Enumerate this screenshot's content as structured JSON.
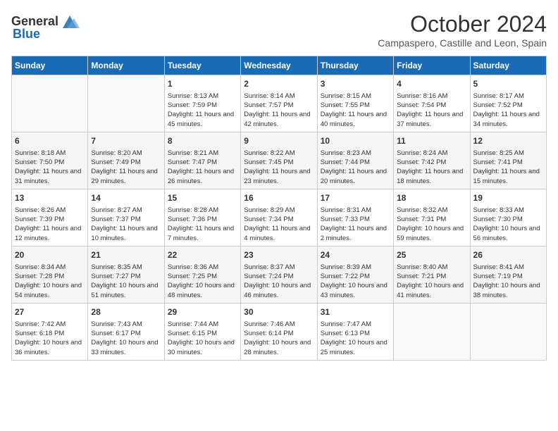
{
  "header": {
    "logo_general": "General",
    "logo_blue": "Blue",
    "month_year": "October 2024",
    "location": "Campaspero, Castille and Leon, Spain"
  },
  "days_of_week": [
    "Sunday",
    "Monday",
    "Tuesday",
    "Wednesday",
    "Thursday",
    "Friday",
    "Saturday"
  ],
  "weeks": [
    [
      {
        "day": "",
        "info": ""
      },
      {
        "day": "",
        "info": ""
      },
      {
        "day": "1",
        "info": "Sunrise: 8:13 AM\nSunset: 7:59 PM\nDaylight: 11 hours and 45 minutes."
      },
      {
        "day": "2",
        "info": "Sunrise: 8:14 AM\nSunset: 7:57 PM\nDaylight: 11 hours and 42 minutes."
      },
      {
        "day": "3",
        "info": "Sunrise: 8:15 AM\nSunset: 7:55 PM\nDaylight: 11 hours and 40 minutes."
      },
      {
        "day": "4",
        "info": "Sunrise: 8:16 AM\nSunset: 7:54 PM\nDaylight: 11 hours and 37 minutes."
      },
      {
        "day": "5",
        "info": "Sunrise: 8:17 AM\nSunset: 7:52 PM\nDaylight: 11 hours and 34 minutes."
      }
    ],
    [
      {
        "day": "6",
        "info": "Sunrise: 8:18 AM\nSunset: 7:50 PM\nDaylight: 11 hours and 31 minutes."
      },
      {
        "day": "7",
        "info": "Sunrise: 8:20 AM\nSunset: 7:49 PM\nDaylight: 11 hours and 29 minutes."
      },
      {
        "day": "8",
        "info": "Sunrise: 8:21 AM\nSunset: 7:47 PM\nDaylight: 11 hours and 26 minutes."
      },
      {
        "day": "9",
        "info": "Sunrise: 8:22 AM\nSunset: 7:45 PM\nDaylight: 11 hours and 23 minutes."
      },
      {
        "day": "10",
        "info": "Sunrise: 8:23 AM\nSunset: 7:44 PM\nDaylight: 11 hours and 20 minutes."
      },
      {
        "day": "11",
        "info": "Sunrise: 8:24 AM\nSunset: 7:42 PM\nDaylight: 11 hours and 18 minutes."
      },
      {
        "day": "12",
        "info": "Sunrise: 8:25 AM\nSunset: 7:41 PM\nDaylight: 11 hours and 15 minutes."
      }
    ],
    [
      {
        "day": "13",
        "info": "Sunrise: 8:26 AM\nSunset: 7:39 PM\nDaylight: 11 hours and 12 minutes."
      },
      {
        "day": "14",
        "info": "Sunrise: 8:27 AM\nSunset: 7:37 PM\nDaylight: 11 hours and 10 minutes."
      },
      {
        "day": "15",
        "info": "Sunrise: 8:28 AM\nSunset: 7:36 PM\nDaylight: 11 hours and 7 minutes."
      },
      {
        "day": "16",
        "info": "Sunrise: 8:29 AM\nSunset: 7:34 PM\nDaylight: 11 hours and 4 minutes."
      },
      {
        "day": "17",
        "info": "Sunrise: 8:31 AM\nSunset: 7:33 PM\nDaylight: 11 hours and 2 minutes."
      },
      {
        "day": "18",
        "info": "Sunrise: 8:32 AM\nSunset: 7:31 PM\nDaylight: 10 hours and 59 minutes."
      },
      {
        "day": "19",
        "info": "Sunrise: 8:33 AM\nSunset: 7:30 PM\nDaylight: 10 hours and 56 minutes."
      }
    ],
    [
      {
        "day": "20",
        "info": "Sunrise: 8:34 AM\nSunset: 7:28 PM\nDaylight: 10 hours and 54 minutes."
      },
      {
        "day": "21",
        "info": "Sunrise: 8:35 AM\nSunset: 7:27 PM\nDaylight: 10 hours and 51 minutes."
      },
      {
        "day": "22",
        "info": "Sunrise: 8:36 AM\nSunset: 7:25 PM\nDaylight: 10 hours and 48 minutes."
      },
      {
        "day": "23",
        "info": "Sunrise: 8:37 AM\nSunset: 7:24 PM\nDaylight: 10 hours and 46 minutes."
      },
      {
        "day": "24",
        "info": "Sunrise: 8:39 AM\nSunset: 7:22 PM\nDaylight: 10 hours and 43 minutes."
      },
      {
        "day": "25",
        "info": "Sunrise: 8:40 AM\nSunset: 7:21 PM\nDaylight: 10 hours and 41 minutes."
      },
      {
        "day": "26",
        "info": "Sunrise: 8:41 AM\nSunset: 7:19 PM\nDaylight: 10 hours and 38 minutes."
      }
    ],
    [
      {
        "day": "27",
        "info": "Sunrise: 7:42 AM\nSunset: 6:18 PM\nDaylight: 10 hours and 36 minutes."
      },
      {
        "day": "28",
        "info": "Sunrise: 7:43 AM\nSunset: 6:17 PM\nDaylight: 10 hours and 33 minutes."
      },
      {
        "day": "29",
        "info": "Sunrise: 7:44 AM\nSunset: 6:15 PM\nDaylight: 10 hours and 30 minutes."
      },
      {
        "day": "30",
        "info": "Sunrise: 7:46 AM\nSunset: 6:14 PM\nDaylight: 10 hours and 28 minutes."
      },
      {
        "day": "31",
        "info": "Sunrise: 7:47 AM\nSunset: 6:13 PM\nDaylight: 10 hours and 25 minutes."
      },
      {
        "day": "",
        "info": ""
      },
      {
        "day": "",
        "info": ""
      }
    ]
  ]
}
